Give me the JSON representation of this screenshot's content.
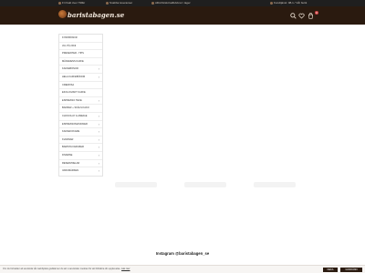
{
  "topbar": {
    "item1": "Fri frakt över 799kr",
    "item2": "Snabba leveranser",
    "item3": "Alltid färskt kaffebönor i lager",
    "right": "Kundtjänst: 08-1 / Vår butik"
  },
  "header": {
    "logo": "baristabagen.se",
    "cart_count": "0",
    "icons": [
      "search-icon",
      "heart-icon",
      "cart-icon"
    ]
  },
  "menu": {
    "items": [
      {
        "label": "KYRKBÖNOR",
        "chevron": false
      },
      {
        "label": "JUL PÅ 2019",
        "chevron": false
      },
      {
        "label": "PRESENTER - TIPS",
        "chevron": false
      },
      {
        "label": "MÅNADENS KAFFE",
        "chevron": false
      },
      {
        "label": "KAFFEBÖNOR",
        "chevron": true
      },
      {
        "label": "HELA KAFFEBÖNOR",
        "chevron": true
      },
      {
        "label": "CREMOSA",
        "chevron": false
      },
      {
        "label": "EKOLOGISKT KAFFE",
        "chevron": false
      },
      {
        "label": "ESPRESSO TEKE",
        "chevron": true
      },
      {
        "label": "BAKBAR + SKÅLS KAKO",
        "chevron": false
      },
      {
        "label": "CHOCOLAY & AMEIGE",
        "chevron": true
      },
      {
        "label": "ESPRESSOMASKINER",
        "chevron": true
      },
      {
        "label": "KAFFEKOKARE",
        "chevron": true
      },
      {
        "label": "KVARNAR",
        "chevron": true
      },
      {
        "label": "BARISTA FARURER",
        "chevron": true
      },
      {
        "label": "DIVERSE",
        "chevron": true
      },
      {
        "label": "RESERVDELAR",
        "chevron": true
      },
      {
        "label": "VARUMÄRKEN",
        "chevron": true
      }
    ]
  },
  "footer": {
    "instagram": "Instagram @baristabagen_se"
  },
  "cookie": {
    "text": "Om du fortsätter att använda vår webbplats godkänner du att vi använder cookies för att förbättra din upplevelse.",
    "link": "Läs mer",
    "decline": "NEKA",
    "accept": "GODKÄNN"
  }
}
